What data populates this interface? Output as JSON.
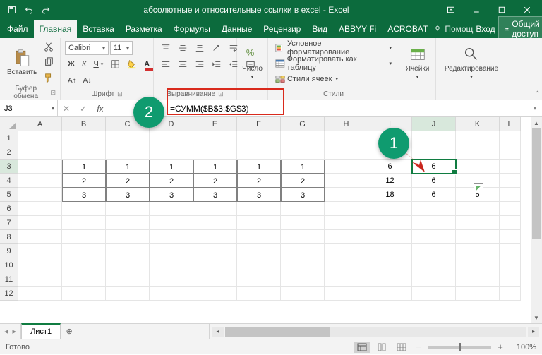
{
  "title": "абсолютные и относительные ссылки в excel - Excel",
  "tabs": {
    "file": "Файл",
    "home": "Главная",
    "insert": "Вставка",
    "layout": "Разметка",
    "formulas": "Формулы",
    "data": "Данные",
    "review": "Рецензир",
    "view": "Вид",
    "abbyy": "ABBYY Fi",
    "acrobat": "ACROBAT",
    "tellme": "Помощ",
    "login": "Вход",
    "share": "Общий доступ"
  },
  "ribbon": {
    "paste": "Вставить",
    "clipboard": "Буфер обмена",
    "font_name": "Calibri",
    "font_size": "11",
    "font_group": "Шрифт",
    "align_group": "Выравнивание",
    "number": "Число",
    "cond_fmt": "Условное форматирование",
    "fmt_table": "Форматировать как таблицу",
    "cell_styles": "Стили ячеек",
    "styles": "Стили",
    "cells": "Ячейки",
    "editing": "Редактирование"
  },
  "namebox": "J3",
  "formula": "=СУММ($B$3:$G$3)",
  "columns": [
    "A",
    "B",
    "C",
    "D",
    "E",
    "F",
    "G",
    "H",
    "I",
    "J",
    "K",
    "L"
  ],
  "rows": [
    "1",
    "2",
    "3",
    "4",
    "5",
    "6",
    "7",
    "8",
    "9",
    "10",
    "11",
    "12"
  ],
  "cells": {
    "B3": "1",
    "C3": "1",
    "D3": "1",
    "E3": "1",
    "F3": "1",
    "G3": "1",
    "B4": "2",
    "C4": "2",
    "D4": "2",
    "E4": "2",
    "F4": "2",
    "G4": "2",
    "B5": "3",
    "C5": "3",
    "D5": "3",
    "E5": "3",
    "F5": "3",
    "G5": "3",
    "I3": "6",
    "J3": "6",
    "I4": "12",
    "J4": "6",
    "I5": "18",
    "J5": "6",
    "K5": "5"
  },
  "callouts": {
    "one": "1",
    "two": "2"
  },
  "sheet": {
    "name": "Лист1"
  },
  "status": {
    "ready": "Готово",
    "zoom": "100%"
  }
}
